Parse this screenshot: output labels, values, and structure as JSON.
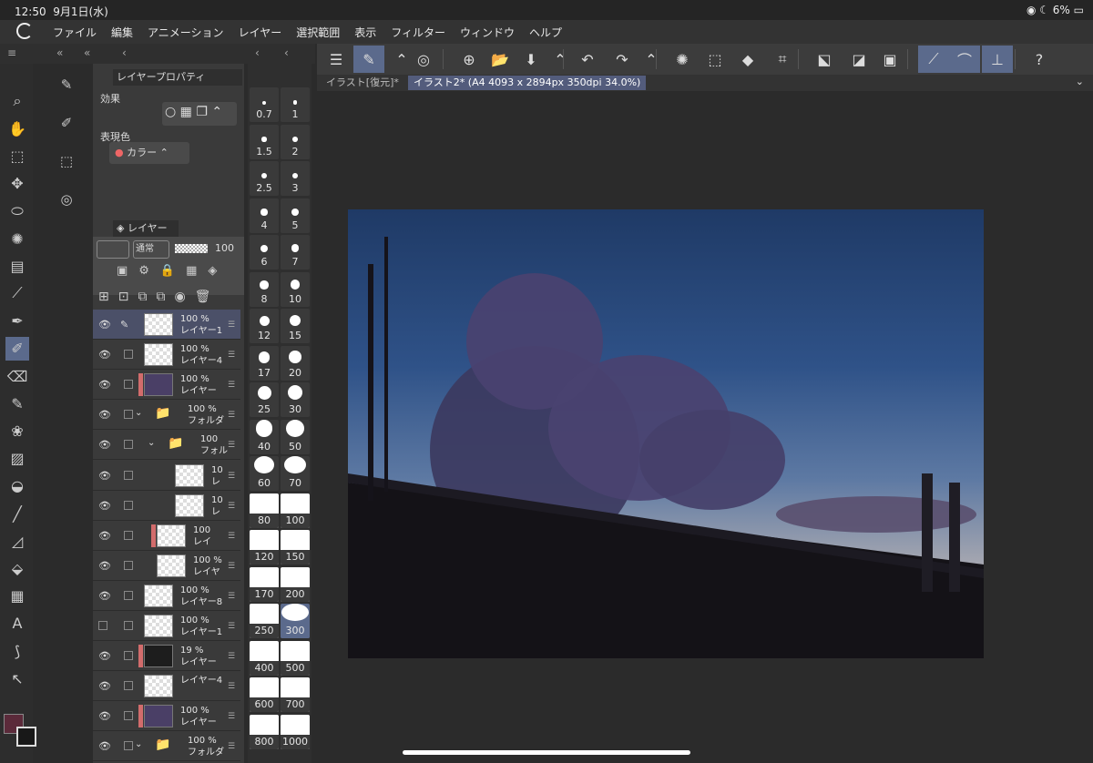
{
  "status": {
    "time": "12:50",
    "date": "9月1日(水)",
    "battery": "6%"
  },
  "menu": [
    "ファイル",
    "編集",
    "アニメーション",
    "レイヤー",
    "選択範囲",
    "表示",
    "フィルター",
    "ウィンドウ",
    "ヘルプ"
  ],
  "tabs": [
    {
      "label": "イラスト[復元]*",
      "active": false
    },
    {
      "label": "イラスト2* (A4 4093 x 2894px 350dpi 34.0%)",
      "active": true
    }
  ],
  "property_panel": {
    "title": "レイヤープロパティ",
    "effect_label": "効果",
    "expression_label": "表現色",
    "expression_value": "カラー"
  },
  "layer_panel": {
    "title": "レイヤー",
    "blend": "通常",
    "opacity": "100"
  },
  "layers": [
    {
      "opacity": "100 %",
      "name": "レイヤー1",
      "kind": "raster",
      "selected": true,
      "visible": true
    },
    {
      "opacity": "100 %",
      "name": "レイヤー4",
      "kind": "raster",
      "visible": true
    },
    {
      "opacity": "100 %",
      "name": "レイヤー",
      "kind": "dark",
      "visible": true,
      "red": true
    },
    {
      "opacity": "100 %",
      "name": "フォルダ",
      "kind": "folder",
      "visible": true
    },
    {
      "opacity": "100",
      "name": "フォル",
      "kind": "folder",
      "visible": true,
      "indent": true
    },
    {
      "opacity": "10",
      "name": "レ",
      "kind": "raster",
      "visible": true,
      "indent2": true
    },
    {
      "opacity": "10",
      "name": "レ",
      "kind": "raster",
      "visible": true,
      "indent2": true
    },
    {
      "opacity": "100",
      "name": "レイ",
      "kind": "raster",
      "visible": true,
      "indent": true,
      "red": true
    },
    {
      "opacity": "100 %",
      "name": "レイヤ",
      "kind": "raster",
      "visible": true,
      "indent": true
    },
    {
      "opacity": "100 %",
      "name": "レイヤー8",
      "kind": "raster",
      "visible": true
    },
    {
      "opacity": "100 %",
      "name": "レイヤー1",
      "kind": "raster",
      "visible": false
    },
    {
      "opacity": "19 %",
      "name": "レイヤー",
      "kind": "black",
      "visible": true,
      "red": true
    },
    {
      "opacity": "",
      "name": "レイヤー4",
      "kind": "raster",
      "visible": true
    },
    {
      "opacity": "100 %",
      "name": "レイヤー",
      "kind": "dark",
      "visible": true,
      "red": true
    },
    {
      "opacity": "100 %",
      "name": "フォルダ",
      "kind": "folder",
      "visible": true
    }
  ],
  "brush_sizes": [
    "0.7",
    "1",
    "1.5",
    "2",
    "2.5",
    "3",
    "4",
    "5",
    "6",
    "7",
    "8",
    "10",
    "12",
    "15",
    "17",
    "20",
    "25",
    "30",
    "40",
    "50",
    "60",
    "70",
    "80",
    "100",
    "120",
    "150",
    "170",
    "200",
    "250",
    "300",
    "400",
    "500",
    "600",
    "700",
    "800",
    "1000"
  ],
  "selected_brush_size": "300",
  "colors": {
    "accent": "#5b6a8c",
    "main_color": "#5b2a3a",
    "sub_color": "#181818"
  }
}
